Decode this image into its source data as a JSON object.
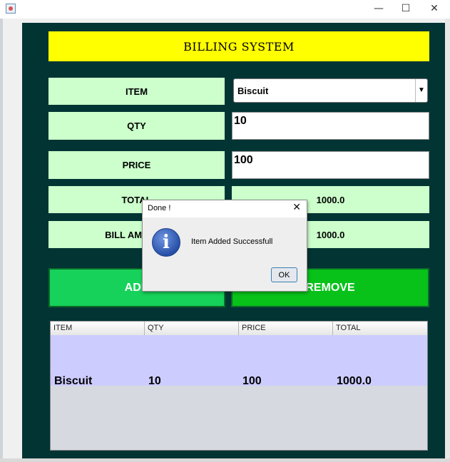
{
  "window": {
    "minimize": "—",
    "maximize": "☐",
    "close": "✕"
  },
  "header": {
    "title": "BILLING SYSTEM"
  },
  "form": {
    "item_label": "ITEM",
    "item_value": "Biscuit",
    "qty_label": "QTY",
    "qty_value": "10",
    "price_label": "PRICE",
    "price_value": "100",
    "total_label": "TOTAL",
    "total_value": "1000.0",
    "bill_label": "BILL AMOUNT",
    "bill_value": "1000.0"
  },
  "buttons": {
    "add": "ADD",
    "remove": "REMOVE"
  },
  "table": {
    "columns": [
      "ITEM",
      "QTY",
      "PRICE",
      "TOTAL"
    ],
    "rows": [
      [
        "Biscuit",
        "10",
        "100",
        "1000.0"
      ]
    ]
  },
  "dialog": {
    "title": "Done !",
    "close": "✕",
    "message": "Item Added Successfull",
    "ok": "OK",
    "icon": "information-icon"
  },
  "colors": {
    "panel": "#033434",
    "header": "#ffff00",
    "label_bg": "#ccffcc",
    "add_button": "#16d25a",
    "remove_button": "#08c21a",
    "table_row": "#ccccff"
  }
}
